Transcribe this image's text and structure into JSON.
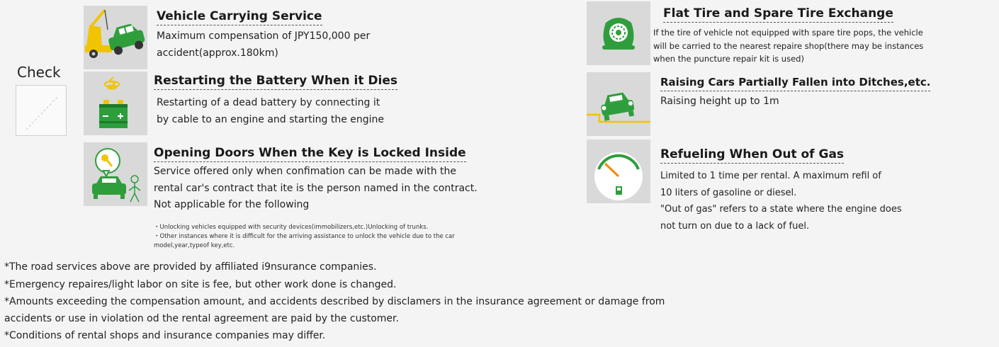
{
  "check": {
    "label": "Check"
  },
  "services_left": [
    {
      "icon": "tow-truck-icon",
      "title": "Vehicle Carrying Service",
      "lines": [
        "Maximum compensation of JPY150,000 per",
        "accident(approx.180km)"
      ]
    },
    {
      "icon": "car-battery-icon",
      "title": "Restarting the Battery When it Dies",
      "lines": [
        "Restarting of a dead battery by connecting it",
        "by cable to an engine and starting the engine"
      ]
    },
    {
      "icon": "key-unlock-icon",
      "title": "Opening Doors When the Key is Locked Inside",
      "lines": [
        "Service offered only when confimation can be made with the",
        "rental car's contract that ite is the person named in the contract.",
        "Not applicable for the following"
      ],
      "fine_print": [
        "・Unlocking vehicles equipped with security devices(immobilizers,etc.)Unlocking of trunks.",
        "・Other instances where it is difficult for the arriving assistance to unlock the vehicle due to the car",
        "model,year,typeof key,etc."
      ]
    }
  ],
  "services_right": [
    {
      "icon": "flat-tire-icon",
      "title": "Flat Tire and Spare Tire Exchange",
      "lines": [
        "If the tire of vehicle not equipped with spare tire pops, the vehicle",
        "will be carried to the nearest repaire shop(there may be instances",
        "when the puncture repair kit is used)"
      ]
    },
    {
      "icon": "car-ditch-icon",
      "title": "Raising Cars Partially Fallen into Ditches,etc.",
      "lines": [
        "Raising height up to 1m"
      ]
    },
    {
      "icon": "fuel-gauge-icon",
      "title": "Refueling When Out of Gas",
      "lines": [
        "Limited to 1 time per rental. A maximum refil of",
        "10 liters of gasoline or diesel.",
        "\"Out of gas\" refers to a state where the engine does",
        "not turn on due to a lack of fuel."
      ]
    }
  ],
  "notes": [
    "*The road services above are provided by affiliated i9nsurance companies.",
    "*Emergency repaires/light labor on site is fee, but other work done is changed.",
    "*Amounts exceeding the compensation amount, and accidents described by disclamers in the insurance agreement or damage from",
    " accidents or use in violation od the rental agreement are paid by the customer.",
    "*Conditions of rental shops and insurance companies may differ."
  ],
  "colors": {
    "icon_green": "#2e9e3c",
    "icon_yellow": "#f0c400",
    "icon_bg": "#d9d9d9",
    "accent_orange": "#f08a00"
  }
}
